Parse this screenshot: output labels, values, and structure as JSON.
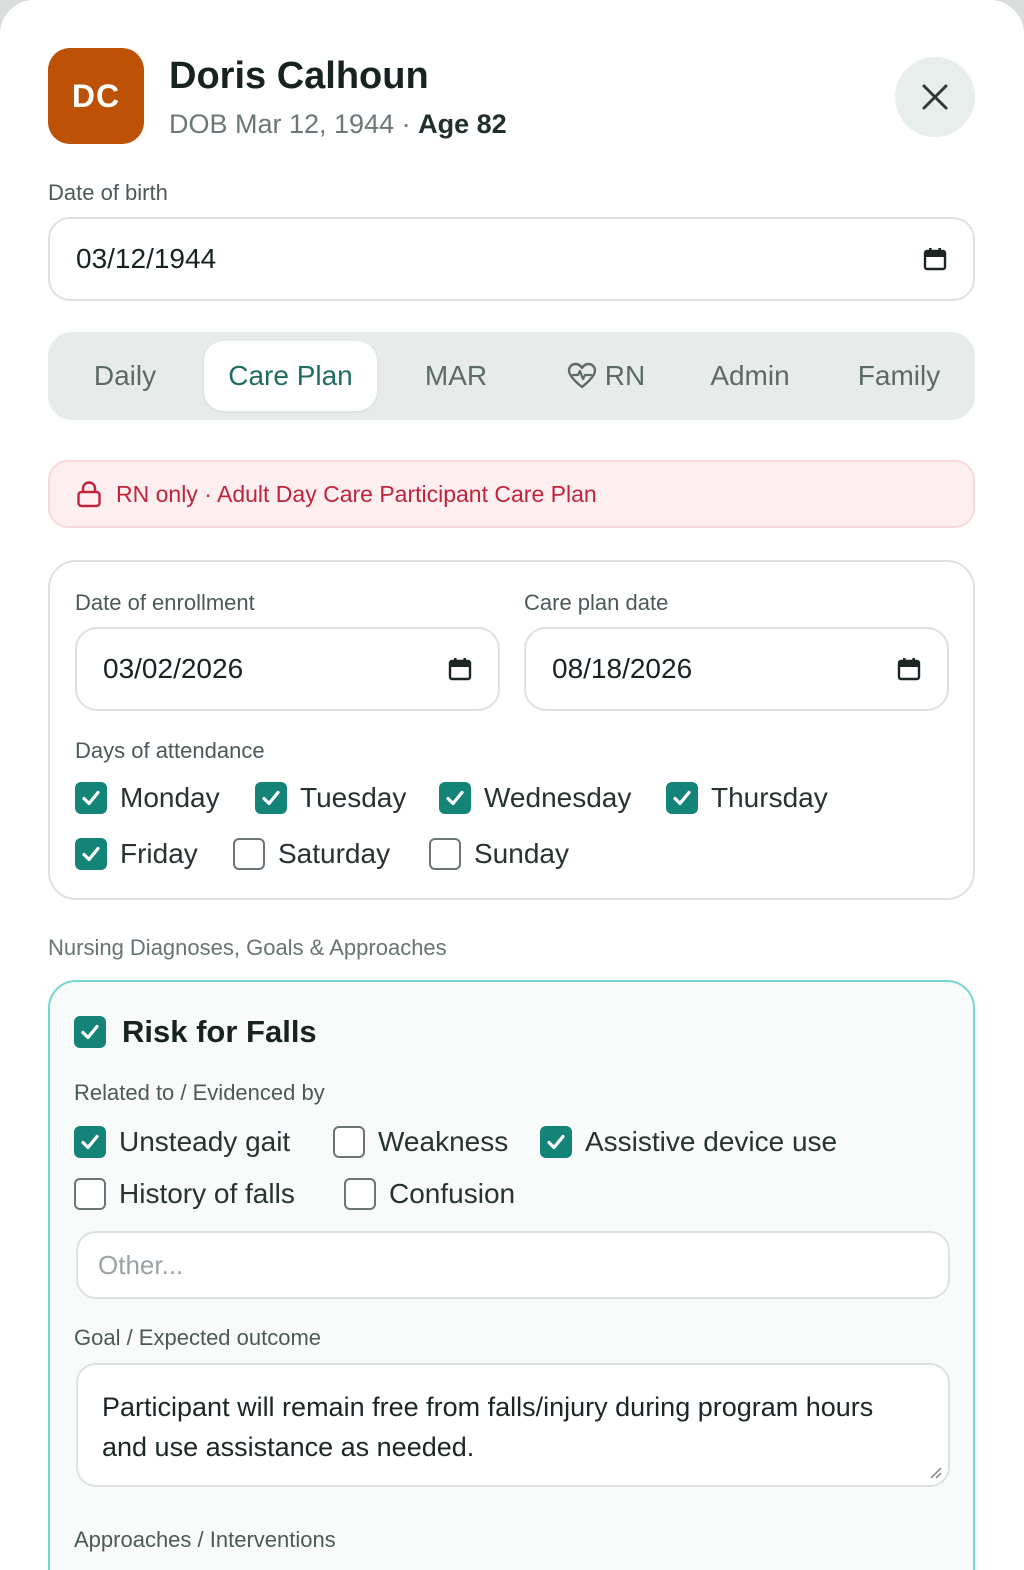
{
  "header": {
    "initials": "DC",
    "avatar_color": "#bd5206",
    "name": "Doris Calhoun",
    "dob_text": "DOB Mar 12, 1944 · ",
    "age_text": "Age 82"
  },
  "dob_field": {
    "label": "Date of birth",
    "value": "03/12/1944"
  },
  "tabs": [
    {
      "label": "Daily"
    },
    {
      "label": "Care Plan",
      "active": true
    },
    {
      "label": "MAR"
    },
    {
      "label": "RN",
      "icon": "heart-pulse-icon"
    },
    {
      "label": "Admin"
    },
    {
      "label": "Family"
    }
  ],
  "banner": {
    "icon": "lock-icon",
    "text": "RN only · Adult Day Care Participant Care Plan"
  },
  "enrollment": {
    "enroll_label": "Date of enrollment",
    "enroll_value": "03/02/2026",
    "plan_label": "Care plan date",
    "plan_value": "08/18/2026",
    "days_label": "Days of attendance",
    "days": [
      {
        "label": "Monday",
        "checked": true
      },
      {
        "label": "Tuesday",
        "checked": true
      },
      {
        "label": "Wednesday",
        "checked": true
      },
      {
        "label": "Thursday",
        "checked": true
      },
      {
        "label": "Friday",
        "checked": true
      },
      {
        "label": "Saturday",
        "checked": false
      },
      {
        "label": "Sunday",
        "checked": false
      }
    ]
  },
  "diagnoses": {
    "section_title": "Nursing Diagnoses, Goals & Approaches",
    "items": [
      {
        "title": "Risk for Falls",
        "checked": true,
        "related_label": "Related to / Evidenced by",
        "factors": [
          {
            "label": "Unsteady gait",
            "checked": true
          },
          {
            "label": "Weakness",
            "checked": false
          },
          {
            "label": "Assistive device use",
            "checked": true
          },
          {
            "label": "History of falls",
            "checked": false
          },
          {
            "label": "Confusion",
            "checked": false
          }
        ],
        "other_placeholder": "Other...",
        "goal_label": "Goal / Expected outcome",
        "goal_text": "Participant will remain free from falls/injury during program hours and use assistance as needed.",
        "approaches_label": "Approaches / Interventions"
      }
    ]
  },
  "colors": {
    "accent": "#148478",
    "active_tab_text": "#1f6c63",
    "banner_text": "#c0243c"
  }
}
